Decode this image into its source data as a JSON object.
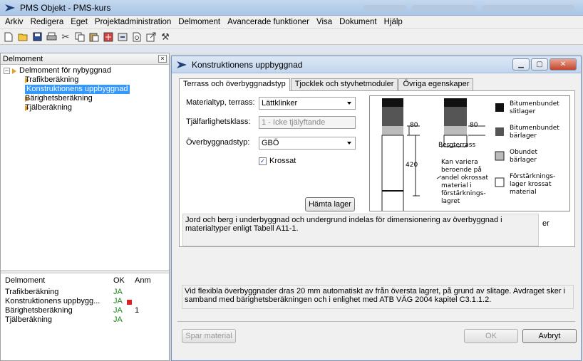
{
  "window": {
    "title": "PMS Objekt - PMS-kurs"
  },
  "menu": [
    "Arkiv",
    "Redigera",
    "Eget",
    "Projektadministration",
    "Delmoment",
    "Avancerade funktioner",
    "Visa",
    "Dokument",
    "Hjälp"
  ],
  "toolbar_icons": [
    "new-icon",
    "open-icon",
    "save-icon",
    "print-icon",
    "cut-icon",
    "copy-icon",
    "paste-icon",
    "calculate-icon",
    "import-icon",
    "print-preview-icon",
    "export-icon",
    "tools-icon"
  ],
  "left_pane": {
    "title": "Delmoment",
    "tree_root": "Delmoment för nybyggnad",
    "tree_items": [
      "Trafikberäkning",
      "Konstruktionens uppbyggnad",
      "Bärighetsberäkning",
      "Tjälberäkning"
    ],
    "table_headers": {
      "name": "Delmoment",
      "ok": "OK",
      "anm": "Anm"
    },
    "table_rows": [
      {
        "name": "Trafikberäkning",
        "ok": "JA",
        "anm": ""
      },
      {
        "name": "Konstruktionens uppbygg...",
        "ok": "JA",
        "anm": ""
      },
      {
        "name": "Bärighetsberäkning",
        "ok": "JA",
        "anm": "1"
      },
      {
        "name": "Tjälberäkning",
        "ok": "JA",
        "anm": ""
      }
    ]
  },
  "dialog": {
    "title": "Konstruktionens uppbyggnad",
    "tabs": [
      "Terrass och överbyggnadstyp",
      "Tjocklek och styvhetmoduler",
      "Övriga egenskaper"
    ],
    "fields": {
      "materialtyp_label": "Materialtyp, terrass:",
      "materialtyp_value": "Lättklinker",
      "tjal_label": "Tjälfarlighetsklass:",
      "tjal_value": "1 - Icke tjälyftande",
      "overbyggnad_label": "Överbyggnadstyp:",
      "overbyggnad_value": "GBÖ",
      "krossat_label": "Krossat"
    },
    "hamta_button": "Hämta lager",
    "info_text_1": "Jord och berg i underbyggnad och undergrund indelas för dimensionering av överbyggnad i materialtyper enligt Tabell A11-1.",
    "info_text_1_overflow": "er",
    "info_text_2": "Vid flexibla överbyggnader dras 20 mm automatiskt av från översta lagret, på grund av slitage. Avdraget sker i samband med bärighetsberäkningen och i enlighet med ATB VÄG 2004 kapitel C3.1.1.2.",
    "spar_button": "Spar material",
    "ok_button": "OK",
    "avbryt_button": "Avbryt",
    "diagram": {
      "dim_80_left": "80",
      "dim_80_right": "80",
      "dim_420": "420",
      "bergterrass": "Bergterrass",
      "note": [
        "Kan variera",
        "beroende på",
        "andel okrossat",
        "material i",
        "förstärknings-",
        "lagret"
      ],
      "legend": [
        {
          "label1": "Bitumenbundet",
          "label2": "slitlager",
          "color": "#111111"
        },
        {
          "label1": "Bitumenbundet",
          "label2": "bärlager",
          "color": "#555555"
        },
        {
          "label1": "Obundet",
          "label2": "bärlager",
          "color": "#bbbbbb"
        },
        {
          "label1": "Förstärknings-",
          "label2": "lager krossat",
          "label3": "material",
          "color": "#ffffff"
        }
      ]
    }
  }
}
